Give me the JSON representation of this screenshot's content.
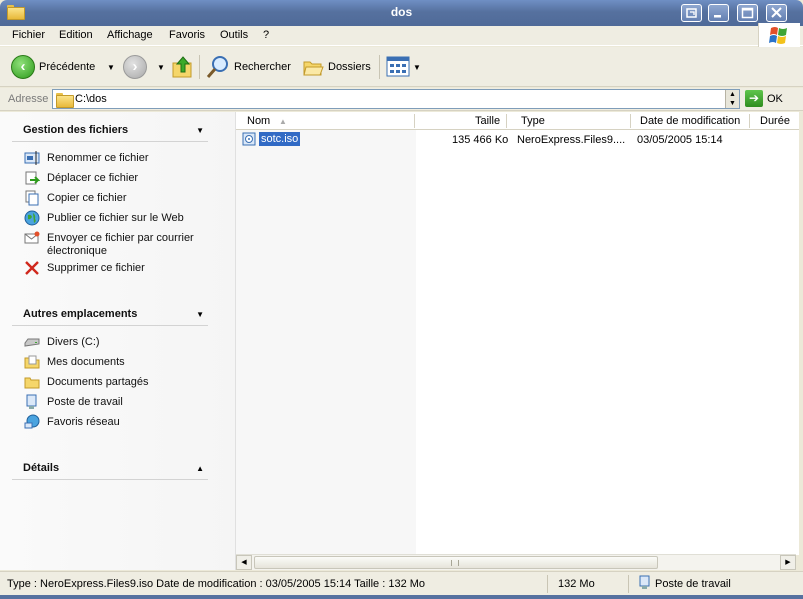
{
  "window": {
    "title": "dos"
  },
  "menu": [
    "Fichier",
    "Edition",
    "Affichage",
    "Favoris",
    "Outils",
    "?"
  ],
  "toolbar": {
    "back_label": "Précédente",
    "search_label": "Rechercher",
    "folders_label": "Dossiers"
  },
  "address": {
    "label": "Adresse",
    "value": "C:\\dos",
    "go_label": "OK"
  },
  "left": {
    "file_tasks": {
      "title": "Gestion des fichiers",
      "items": [
        "Renommer ce fichier",
        "Déplacer ce fichier",
        "Copier ce fichier",
        "Publier ce fichier sur le Web",
        "Envoyer ce fichier par courrier électronique",
        "Supprimer ce fichier"
      ]
    },
    "other_places": {
      "title": "Autres emplacements",
      "items": [
        "Divers (C:)",
        "Mes documents",
        "Documents partagés",
        "Poste de travail",
        "Favoris réseau"
      ]
    },
    "details": {
      "title": "Détails"
    }
  },
  "list": {
    "columns": [
      "Nom",
      "Taille",
      "Type",
      "Date de modification",
      "Durée"
    ],
    "rows": [
      {
        "name": "sotc.iso",
        "size": "135 466 Ko",
        "type": "NeroExpress.Files9....",
        "modified": "03/05/2005 15:14"
      }
    ]
  },
  "status": {
    "info": "Type : NeroExpress.Files9.iso Date de modification : 03/05/2005 15:14 Taille  : 132 Mo",
    "size": "132 Mo",
    "zone": "Poste de travail"
  },
  "colors": {
    "titlebar": "#56719F",
    "selection": "#316AC5",
    "chrome": "#EFEDE2"
  }
}
